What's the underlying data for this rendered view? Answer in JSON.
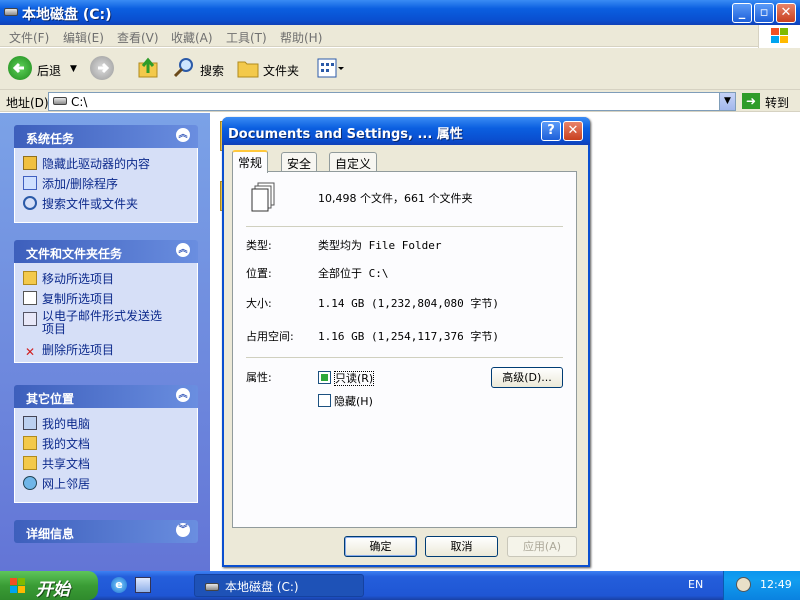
{
  "window": {
    "title": "本地磁盘 (C:)"
  },
  "menu": [
    "文件(F)",
    "编辑(E)",
    "查看(V)",
    "收藏(A)",
    "工具(T)",
    "帮助(H)"
  ],
  "toolbar": {
    "back": "后退",
    "search": "搜索",
    "folders": "文件夹"
  },
  "address": {
    "label": "地址(D)",
    "value": "C:\\",
    "go": "转到"
  },
  "sidebar": {
    "system_tasks": {
      "title": "系统任务",
      "items": [
        "隐藏此驱动器的内容",
        "添加/删除程序",
        "搜索文件或文件夹"
      ]
    },
    "file_tasks": {
      "title": "文件和文件夹任务",
      "items": [
        "移动所选项目",
        "复制所选项目",
        "以电子邮件形式发送选\n项目",
        "删除所选项目"
      ]
    },
    "other_places": {
      "title": "其它位置",
      "items": [
        "我的电脑",
        "我的文档",
        "共享文档",
        "网上邻居"
      ]
    },
    "details": {
      "title": "详细信息"
    }
  },
  "dialog": {
    "title": "Documents and Settings, ... 属性",
    "tabs": [
      "常规",
      "安全",
      "自定义"
    ],
    "summary": "10,498 个文件，661 个文件夹",
    "type_label": "类型:",
    "type_value": "类型均为 File Folder",
    "location_label": "位置:",
    "location_value": "全部位于 C:\\",
    "size_label": "大小:",
    "size_value": "1.14 GB (1,232,804,080 字节)",
    "disk_label": "占用空间:",
    "disk_value": "1.16 GB (1,254,117,376 字节)",
    "attr_label": "属性:",
    "readonly": "只读(R)",
    "hidden": "隐藏(H)",
    "advanced": "高级(D)...",
    "ok": "确定",
    "cancel": "取消",
    "apply": "应用(A)"
  },
  "taskbar": {
    "start": "开始",
    "window": "本地磁盘 (C:)",
    "lang": "EN",
    "clock": "12:49"
  }
}
